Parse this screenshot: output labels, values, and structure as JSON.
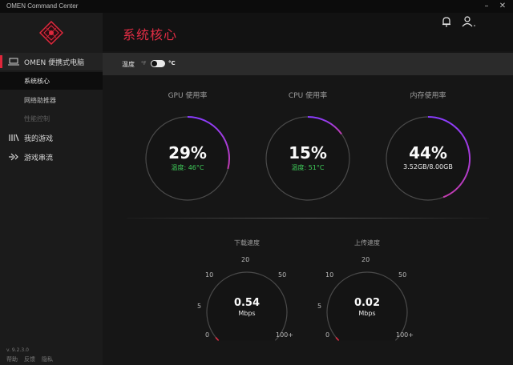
{
  "window": {
    "title": "OMEN Command Center"
  },
  "sidebar": {
    "section": {
      "label": "OMEN 便携式电脑"
    },
    "sub_items": [
      {
        "label": "系统核心"
      },
      {
        "label": "网络助推器"
      },
      {
        "label": "性能控制"
      }
    ],
    "items": [
      {
        "label": "我的游戏"
      },
      {
        "label": "游戏串流"
      }
    ],
    "version": "v. 9.2.3.0",
    "footer": [
      "帮助",
      "反馈",
      "隐私"
    ]
  },
  "header": {
    "title": "系统核心"
  },
  "temperature": {
    "label": "温度",
    "unit_f": "°F",
    "unit_c": "°C"
  },
  "gauges": [
    {
      "label": "GPU 使用率",
      "value": "29%",
      "detail": "温度: 46°C",
      "percent": 29,
      "detail_color": "#3fcf5a"
    },
    {
      "label": "CPU 使用率",
      "value": "15%",
      "detail": "温度: 51°C",
      "percent": 15,
      "detail_color": "#3fcf5a"
    },
    {
      "label": "内存使用率",
      "value": "44%",
      "detail": "3.52GB/8.00GB",
      "percent": 44,
      "detail_color": "#e8e8e8"
    }
  ],
  "speeds": [
    {
      "label": "下载速度",
      "value": "0.54",
      "unit": "Mbps",
      "ticks": [
        "0",
        "5",
        "10",
        "20",
        "50",
        "100+"
      ]
    },
    {
      "label": "上传速度",
      "value": "0.02",
      "unit": "Mbps",
      "ticks": [
        "0",
        "5",
        "10",
        "20",
        "50",
        "100+"
      ]
    }
  ],
  "colors": {
    "accent": "#e32d45",
    "ring_gradient_start": "#8a3cff",
    "ring_gradient_end": "#c33cb0"
  }
}
